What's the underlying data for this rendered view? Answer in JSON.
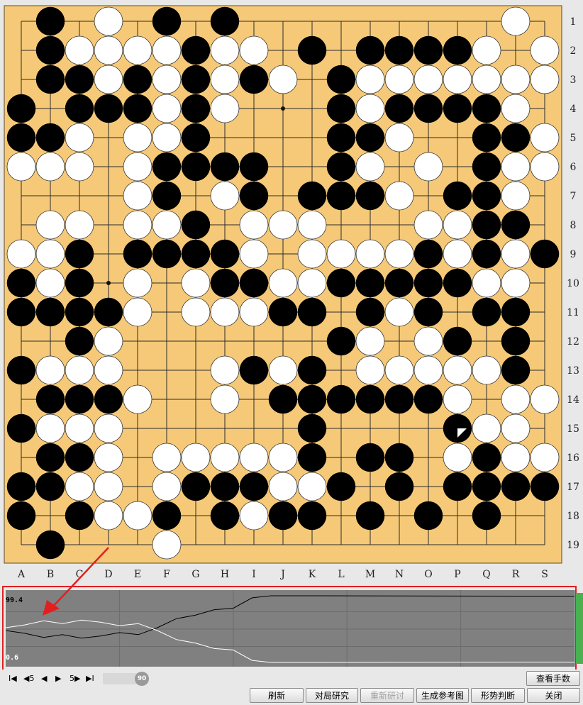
{
  "board": {
    "size": 19,
    "columns": [
      "A",
      "B",
      "C",
      "D",
      "E",
      "F",
      "G",
      "H",
      "I",
      "J",
      "K",
      "L",
      "M",
      "N",
      "O",
      "P",
      "Q",
      "R",
      "S"
    ],
    "rows": [
      "1",
      "2",
      "3",
      "4",
      "5",
      "6",
      "7",
      "8",
      "9",
      "10",
      "11",
      "12",
      "13",
      "14",
      "15",
      "16",
      "17",
      "18",
      "19"
    ],
    "star_points": [
      "J4",
      "D10",
      "P16"
    ],
    "black": [
      "B1",
      "F1",
      "H1",
      "B2",
      "G2",
      "K2",
      "M2",
      "N2",
      "O2",
      "P2",
      "B3",
      "C3",
      "E3",
      "G3",
      "I3",
      "L3",
      "A4",
      "C4",
      "D4",
      "E4",
      "G4",
      "L4",
      "N4",
      "O4",
      "P4",
      "Q4",
      "A5",
      "B5",
      "G5",
      "L5",
      "M5",
      "Q5",
      "R5",
      "F6",
      "G6",
      "H6",
      "I6",
      "L6",
      "Q6",
      "F7",
      "I7",
      "K7",
      "L7",
      "M7",
      "P7",
      "Q7",
      "G8",
      "Q8",
      "R8",
      "C9",
      "E9",
      "F9",
      "G9",
      "H9",
      "O9",
      "Q9",
      "S9",
      "A10",
      "C10",
      "H10",
      "I10",
      "L10",
      "M10",
      "N10",
      "O10",
      "P10",
      "A11",
      "B11",
      "C11",
      "D11",
      "J11",
      "K11",
      "M11",
      "O11",
      "Q11",
      "R11",
      "C12",
      "L12",
      "P12",
      "R12",
      "A13",
      "B13",
      "I13",
      "K13",
      "R13",
      "B14",
      "C14",
      "D14",
      "J14",
      "K14",
      "L14",
      "M14",
      "N14",
      "O14",
      "A15",
      "K15",
      "P15",
      "B16",
      "C16",
      "K16",
      "M16",
      "N16",
      "Q16",
      "A17",
      "B17",
      "G17",
      "H17",
      "I17",
      "L17",
      "N17",
      "P17",
      "Q17",
      "R17",
      "S17",
      "A18",
      "C18",
      "F18",
      "H18",
      "J18",
      "K18",
      "M18",
      "O18",
      "Q18",
      "B19"
    ],
    "white": [
      "D1",
      "R1",
      "C2",
      "D2",
      "E2",
      "F2",
      "H2",
      "I2",
      "Q2",
      "S2",
      "D3",
      "F3",
      "H3",
      "J3",
      "M3",
      "N3",
      "O3",
      "P3",
      "Q3",
      "R3",
      "S3",
      "F4",
      "H4",
      "M4",
      "R4",
      "C5",
      "E5",
      "F5",
      "N5",
      "S5",
      "A6",
      "B6",
      "C6",
      "E6",
      "M6",
      "O6",
      "R6",
      "S6",
      "E7",
      "H7",
      "N7",
      "R7",
      "B8",
      "C8",
      "E8",
      "F8",
      "I8",
      "J8",
      "K8",
      "O8",
      "P8",
      "A9",
      "B9",
      "I9",
      "K9",
      "L9",
      "M9",
      "N9",
      "P9",
      "R9",
      "B10",
      "E10",
      "G10",
      "J10",
      "K10",
      "Q10",
      "R10",
      "E11",
      "G11",
      "H11",
      "I11",
      "N11",
      "D12",
      "M12",
      "O12",
      "B13",
      "C13",
      "D13",
      "H13",
      "J13",
      "M13",
      "N13",
      "O13",
      "P13",
      "Q13",
      "E14",
      "H14",
      "P14",
      "R14",
      "S14",
      "B15",
      "C15",
      "D15",
      "Q15",
      "R15",
      "D16",
      "F16",
      "G16",
      "H16",
      "I16",
      "J16",
      "P16",
      "R16",
      "S16",
      "C17",
      "D17",
      "F17",
      "J17",
      "K17",
      "D18",
      "E18",
      "I18",
      "F19"
    ],
    "last_move": "P15"
  },
  "graph": {
    "max_label": "99.4",
    "min_label": "0.6",
    "black_line": [
      [
        0,
        0.52
      ],
      [
        3,
        0.56
      ],
      [
        6,
        0.62
      ],
      [
        9,
        0.58
      ],
      [
        12,
        0.63
      ],
      [
        15,
        0.6
      ],
      [
        18,
        0.55
      ],
      [
        21,
        0.58
      ],
      [
        24,
        0.48
      ],
      [
        27,
        0.35
      ],
      [
        30,
        0.3
      ],
      [
        33,
        0.22
      ],
      [
        36,
        0.2
      ],
      [
        39,
        0.05
      ],
      [
        42,
        0.02
      ],
      [
        50,
        0.02
      ],
      [
        80,
        0.025
      ],
      [
        90,
        0.025
      ]
    ],
    "white_line": [
      [
        0,
        0.48
      ],
      [
        3,
        0.44
      ],
      [
        6,
        0.38
      ],
      [
        9,
        0.42
      ],
      [
        12,
        0.37
      ],
      [
        15,
        0.4
      ],
      [
        18,
        0.45
      ],
      [
        21,
        0.42
      ],
      [
        24,
        0.52
      ],
      [
        27,
        0.65
      ],
      [
        30,
        0.7
      ],
      [
        33,
        0.78
      ],
      [
        36,
        0.8
      ],
      [
        39,
        0.95
      ],
      [
        42,
        0.98
      ],
      [
        50,
        0.98
      ],
      [
        80,
        0.975
      ],
      [
        90,
        0.975
      ]
    ],
    "total_moves": 90
  },
  "navigation": {
    "first_label": "I◀",
    "back5_label": "◀5",
    "back_label": "◀",
    "forward_label": "▶",
    "forward5_label": "5▶",
    "last_label": "▶I",
    "current_move": "90"
  },
  "buttons": {
    "view_moves": "查看手数",
    "refresh": "刷新",
    "game_study": "对局研究",
    "re_review": "重新研讨",
    "reference_map": "生成参考图",
    "position_judge": "形势判断",
    "close": "关闭"
  },
  "colors": {
    "board": "#f5c978",
    "graph_bg": "#808080",
    "annotation_red": "#e02020"
  }
}
